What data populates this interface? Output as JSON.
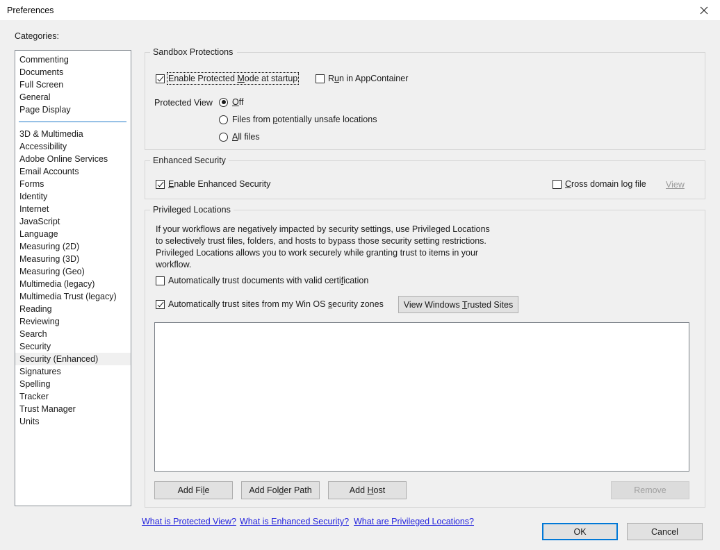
{
  "window": {
    "title": "Preferences",
    "close_icon": "close-icon"
  },
  "colors": {
    "accent_blue": "#0078d7",
    "separator_blue": "#1c78c8",
    "link_blue": "#2222dd",
    "dialog_bg": "#f0f0f0",
    "disabled_text": "#a0a0a0"
  },
  "sidebar": {
    "label": "Categories:",
    "selected": "Security (Enhanced)",
    "group_one": [
      {
        "label": "Commenting"
      },
      {
        "label": "Documents"
      },
      {
        "label": "Full Screen"
      },
      {
        "label": "General"
      },
      {
        "label": "Page Display"
      }
    ],
    "group_two": [
      {
        "label": "3D & Multimedia"
      },
      {
        "label": "Accessibility"
      },
      {
        "label": "Adobe Online Services"
      },
      {
        "label": "Email Accounts"
      },
      {
        "label": "Forms"
      },
      {
        "label": "Identity"
      },
      {
        "label": "Internet"
      },
      {
        "label": "JavaScript"
      },
      {
        "label": "Language"
      },
      {
        "label": "Measuring (2D)"
      },
      {
        "label": "Measuring (3D)"
      },
      {
        "label": "Measuring (Geo)"
      },
      {
        "label": "Multimedia (legacy)"
      },
      {
        "label": "Multimedia Trust (legacy)"
      },
      {
        "label": "Reading"
      },
      {
        "label": "Reviewing"
      },
      {
        "label": "Search"
      },
      {
        "label": "Security"
      },
      {
        "label": "Security (Enhanced)"
      },
      {
        "label": "Signatures"
      },
      {
        "label": "Spelling"
      },
      {
        "label": "Tracker"
      },
      {
        "label": "Trust Manager"
      },
      {
        "label": "Units"
      }
    ]
  },
  "sandbox": {
    "legend": "Sandbox Protections",
    "enable_protected_mode": {
      "label_pre": "Enable Protected ",
      "label_accel": "M",
      "label_post": "ode at startup",
      "checked": true,
      "focused": true
    },
    "run_in_appcontainer": {
      "label_pre": "R",
      "label_accel": "u",
      "label_post": "n in AppContainer",
      "checked": false
    },
    "protected_view_label": "Protected View",
    "protected_view_options": [
      {
        "label_pre": "",
        "label_accel": "O",
        "label_post": "ff",
        "selected": true
      },
      {
        "label_pre": "Files from ",
        "label_accel": "p",
        "label_post": "otentially unsafe locations",
        "selected": false
      },
      {
        "label_pre": "",
        "label_accel": "A",
        "label_post": "ll files",
        "selected": false
      }
    ]
  },
  "enhanced_security": {
    "legend": "Enhanced Security",
    "enable": {
      "label_pre": "",
      "label_accel": "E",
      "label_post": "nable Enhanced Security",
      "checked": true
    },
    "cross_domain_log": {
      "label_pre": "",
      "label_accel": "C",
      "label_post": "ross domain log file",
      "checked": false
    },
    "view_link": "View",
    "view_link_disabled": true
  },
  "privileged_locations": {
    "legend": "Privileged Locations",
    "description": "If your workflows are negatively impacted by security settings, use Privileged Locations to selectively trust files, folders, and hosts to bypass those security setting restrictions. Privileged Locations allows you to work securely while granting trust to items in your workflow.",
    "auto_trust_documents": {
      "label_pre": "Automatically trust documents with valid certi",
      "label_accel": "f",
      "label_post": "ication",
      "checked": false
    },
    "auto_trust_sites": {
      "label_pre": "Automatically trust sites from my Win OS ",
      "label_accel": "s",
      "label_post": "ecurity zones",
      "checked": true
    },
    "view_trusted_sites_button": {
      "label_pre": "View Windows ",
      "label_accel": "T",
      "label_post": "rusted Sites"
    },
    "list_items": [],
    "buttons": {
      "add_file": {
        "label_pre": "Add Fi",
        "label_accel": "l",
        "label_post": "e"
      },
      "add_folder_path": {
        "label_pre": "Add Fol",
        "label_accel": "d",
        "label_post": "er Path"
      },
      "add_host": {
        "label_pre": "Add ",
        "label_accel": "H",
        "label_post": "ost"
      },
      "remove": {
        "label": "Remove",
        "disabled": true
      }
    }
  },
  "help_links": [
    {
      "label": "What is Protected View?"
    },
    {
      "label": "What is Enhanced Security?"
    },
    {
      "label": "What are Privileged Locations?"
    }
  ],
  "footer": {
    "ok": "OK",
    "cancel": "Cancel"
  }
}
